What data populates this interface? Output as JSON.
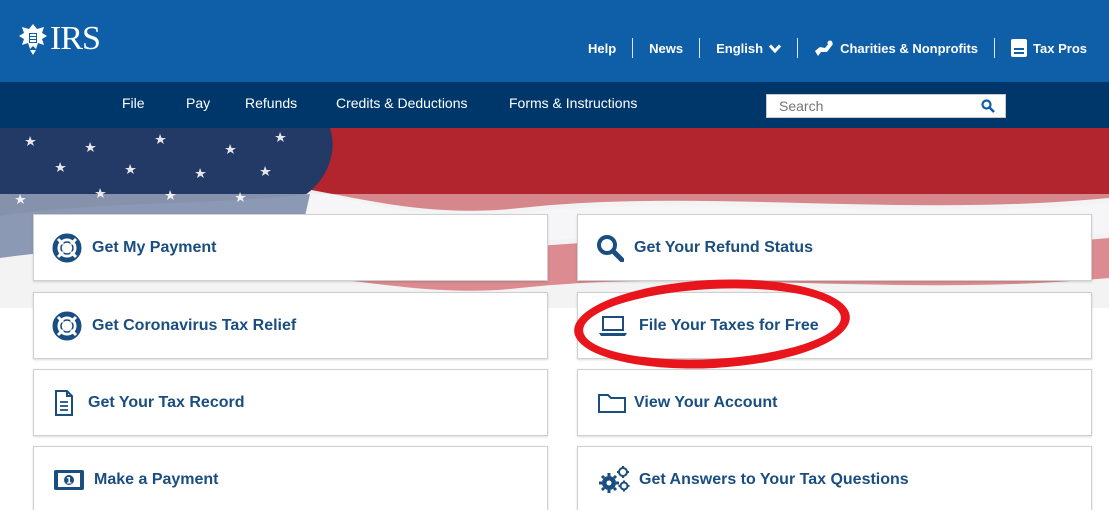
{
  "header": {
    "logo_text": "IRS",
    "utility_links": [
      {
        "label": "Help"
      },
      {
        "label": "News"
      },
      {
        "label": "English"
      },
      {
        "label": "Charities & Nonprofits"
      },
      {
        "label": "Tax Pros"
      }
    ]
  },
  "nav": {
    "items": [
      {
        "label": "File"
      },
      {
        "label": "Pay"
      },
      {
        "label": "Refunds"
      },
      {
        "label": "Credits & Deductions"
      },
      {
        "label": "Forms & Instructions"
      }
    ],
    "search_placeholder": "Search"
  },
  "cards": [
    {
      "label": "Get My Payment",
      "icon": "lifebuoy-icon"
    },
    {
      "label": "Get Your Refund Status",
      "icon": "magnifier-icon"
    },
    {
      "label": "Get Coronavirus Tax Relief",
      "icon": "lifebuoy-icon"
    },
    {
      "label": "File Your Taxes for Free",
      "icon": "laptop-icon"
    },
    {
      "label": "Get Your Tax Record",
      "icon": "document-icon"
    },
    {
      "label": "View Your Account",
      "icon": "folder-icon"
    },
    {
      "label": "Make a Payment",
      "icon": "cash-icon"
    },
    {
      "label": "Get Answers to Your Tax Questions",
      "icon": "gears-icon"
    }
  ],
  "colors": {
    "header_blue": "#0f5ea8",
    "nav_navy": "#00376b",
    "card_text": "#1a4d80",
    "annotation_red": "#e8151d"
  }
}
